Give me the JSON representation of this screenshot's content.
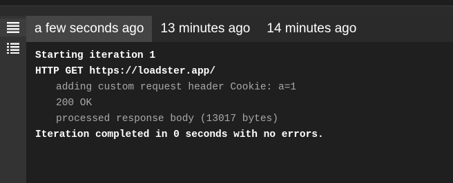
{
  "tabs": [
    {
      "label": "a few seconds ago",
      "active": true
    },
    {
      "label": "13 minutes ago",
      "active": false
    },
    {
      "label": "14 minutes ago",
      "active": false
    }
  ],
  "sidebar": {
    "items": [
      {
        "icon": "text-lines-icon",
        "active": true
      },
      {
        "icon": "list-icon",
        "active": false
      }
    ]
  },
  "log": {
    "lines": [
      "Starting iteration 1",
      "HTTP GET https://loadster.app/",
      "adding custom request header Cookie: a=1",
      "200 OK",
      "processed response body (13017 bytes)",
      "Iteration completed in 0 seconds with no errors."
    ]
  },
  "colors": {
    "primary_text": "#ffffff",
    "detail_text": "#a9a9a9",
    "log_background": "#1f1f1f",
    "active_tab": "#454545"
  }
}
